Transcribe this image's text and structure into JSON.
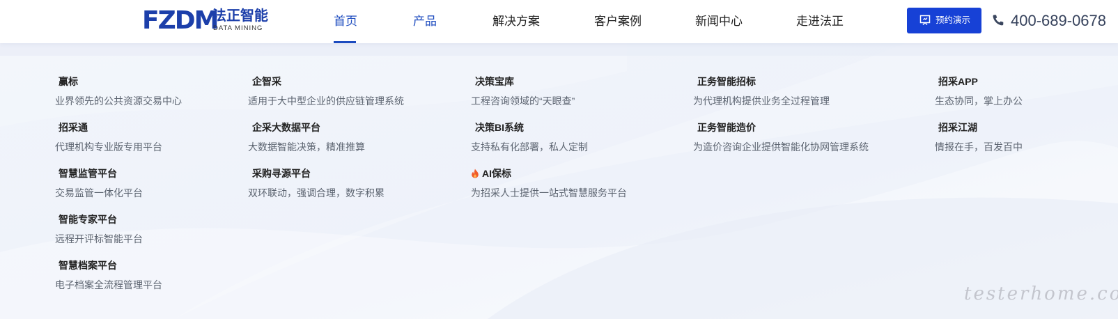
{
  "brand": {
    "logo_main": "FZDM",
    "logo_cn": "法正智能",
    "logo_en": "DATA MINING",
    "accent_color": "#1c4bbf"
  },
  "nav": {
    "items": [
      {
        "label": "首页",
        "state": "active"
      },
      {
        "label": "产品",
        "state": "hover"
      },
      {
        "label": "解决方案",
        "state": "normal"
      },
      {
        "label": "客户案例",
        "state": "normal"
      },
      {
        "label": "新闻中心",
        "state": "normal"
      },
      {
        "label": "走进法正",
        "state": "normal"
      }
    ]
  },
  "header_actions": {
    "demo_button": {
      "label": "预约演示",
      "icon": "presentation-icon",
      "color": "#1741d6"
    },
    "phone": {
      "icon": "phone-icon",
      "number": "400-689-0678"
    }
  },
  "products": {
    "columns": [
      [
        {
          "title": "赢标",
          "desc": "业界领先的公共资源交易中心"
        },
        {
          "title": "招采通",
          "desc": "代理机构专业版专用平台"
        },
        {
          "title": "智慧监管平台",
          "desc": "交易监管一体化平台"
        },
        {
          "title": "智能专家平台",
          "desc": "远程开评标智能平台"
        },
        {
          "title": "智慧档案平台",
          "desc": "电子档案全流程管理平台"
        }
      ],
      [
        {
          "title": "企智采",
          "desc": "适用于大中型企业的供应链管理系统"
        },
        {
          "title": "企采大数据平台",
          "desc": "大数据智能决策，精准推算"
        },
        {
          "title": "采购寻源平台",
          "desc": "双环联动，强调合理，数字积累"
        }
      ],
      [
        {
          "title": "决策宝库",
          "desc": "工程咨询领域的“天眼查”"
        },
        {
          "title": "决策BI系统",
          "desc": "支持私有化部署，私人定制"
        },
        {
          "title": "AI保标",
          "desc": "为招采人士提供一站式智慧服务平台",
          "icon": "fire-icon"
        }
      ],
      [
        {
          "title": "正务智能招标",
          "desc": "为代理机构提供业务全过程管理"
        },
        {
          "title": "正务智能造价",
          "desc": "为造价咨询企业提供智能化协网管理系统"
        }
      ],
      [
        {
          "title": "招采APP",
          "desc": "生态协同，掌上办公"
        },
        {
          "title": "招采江湖",
          "desc": "情报在手，百发百中"
        }
      ]
    ]
  },
  "watermark": "testerhome.com"
}
